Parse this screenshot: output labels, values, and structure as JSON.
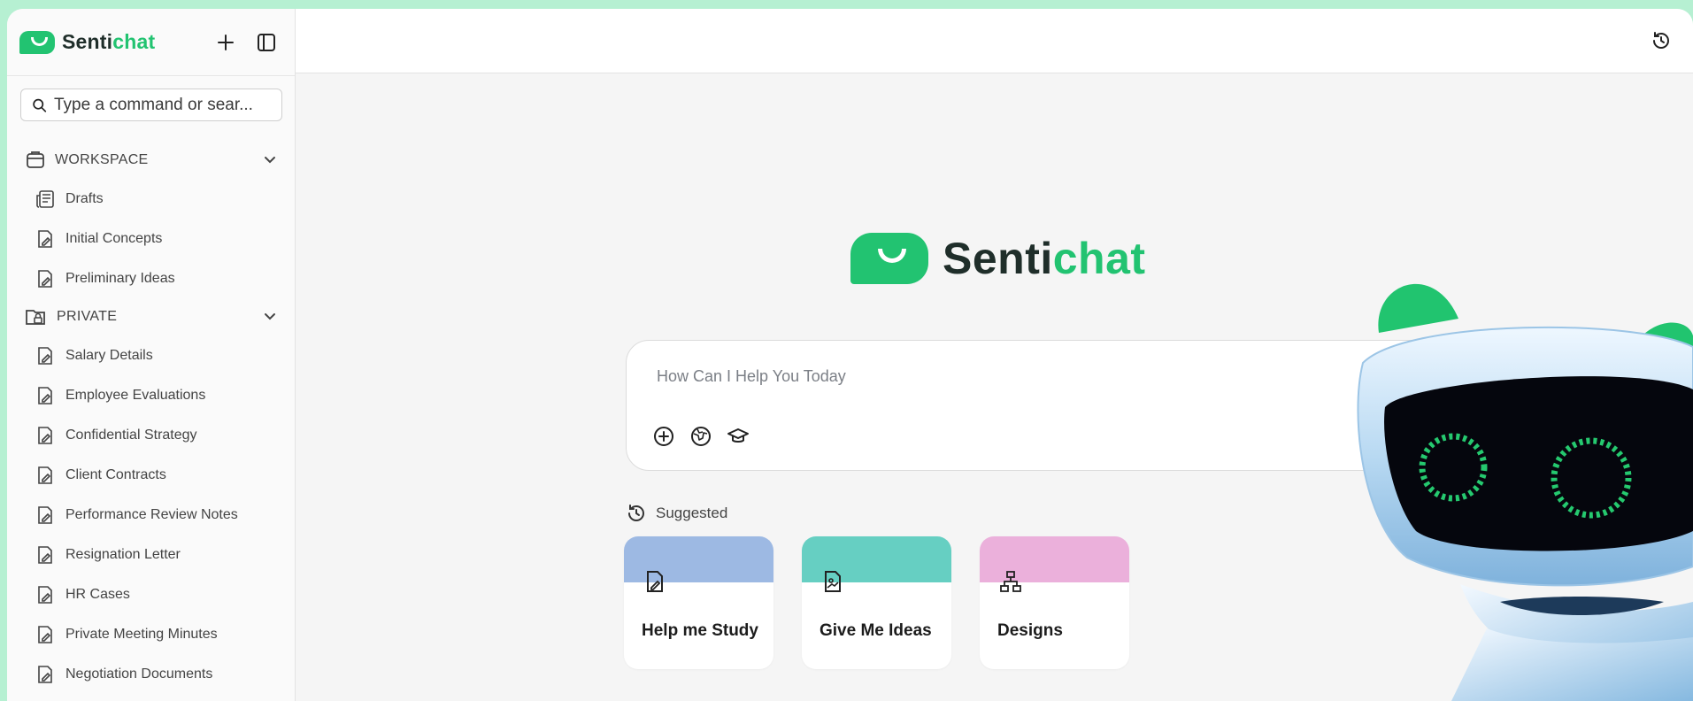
{
  "brand": {
    "name_prefix": "Senti",
    "name_suffix": "chat"
  },
  "sidebar": {
    "search_placeholder": "Type a command or sear...",
    "sections": [
      {
        "label": "WORKSPACE",
        "items": [
          "Drafts",
          "Initial Concepts",
          "Preliminary Ideas"
        ]
      },
      {
        "label": "PRIVATE",
        "items": [
          "Salary Details",
          "Employee Evaluations",
          "Confidential Strategy",
          "Client Contracts",
          "Performance Review Notes",
          "Resignation Letter",
          "HR Cases",
          "Private Meeting Minutes",
          "Negotiation Documents"
        ]
      }
    ]
  },
  "main": {
    "prompt_placeholder": "How Can I Help You Today",
    "suggested_label": "Suggested",
    "cards": [
      {
        "title": "Help me Study",
        "color": "#9db9e3",
        "icon": "edit-doc-icon"
      },
      {
        "title": "Give Me Ideas",
        "color": "#66cfc2",
        "icon": "image-doc-icon"
      },
      {
        "title": "Designs",
        "color": "#ebb0db",
        "icon": "hierarchy-icon"
      }
    ]
  },
  "colors": {
    "accent": "#22c371",
    "background": "#b6f0d2"
  }
}
